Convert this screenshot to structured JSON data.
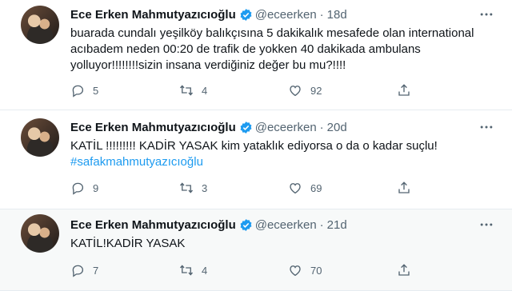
{
  "tweets": [
    {
      "name": "Ece Erken Mahmutyazıcıoğlu",
      "handle": "@eceerken",
      "time": "18d",
      "text": "buarada cundalı yeşilköy balıkçısına 5 dakikalık mesafede olan international acıbadem neden 00:20 de trafik de yokken 40 dakikada ambulans yolluyor!!!!!!!!sizin insana verdiğiniz değer bu mu?!!!!",
      "hashtag": "",
      "replies": "5",
      "retweets": "4",
      "likes": "92"
    },
    {
      "name": "Ece Erken Mahmutyazıcıoğlu",
      "handle": "@eceerken",
      "time": "20d",
      "text": "KATİL !!!!!!!!! KADİR YASAK kim yataklık ediyorsa o da o kadar suçlu!",
      "hashtag": "#safakmahmutyazıcıoğlu",
      "replies": "9",
      "retweets": "3",
      "likes": "69"
    },
    {
      "name": "Ece Erken Mahmutyazıcıoğlu",
      "handle": "@eceerken",
      "time": "21d",
      "text": "KATİL!KADİR YASAK",
      "hashtag": "",
      "replies": "7",
      "retweets": "4",
      "likes": "70"
    }
  ],
  "colors": {
    "accent": "#1d9bf0",
    "muted": "#536471",
    "text": "#0f1419"
  },
  "icons": [
    "verified-badge-icon",
    "more-icon",
    "reply-icon",
    "retweet-icon",
    "like-icon",
    "share-icon"
  ]
}
